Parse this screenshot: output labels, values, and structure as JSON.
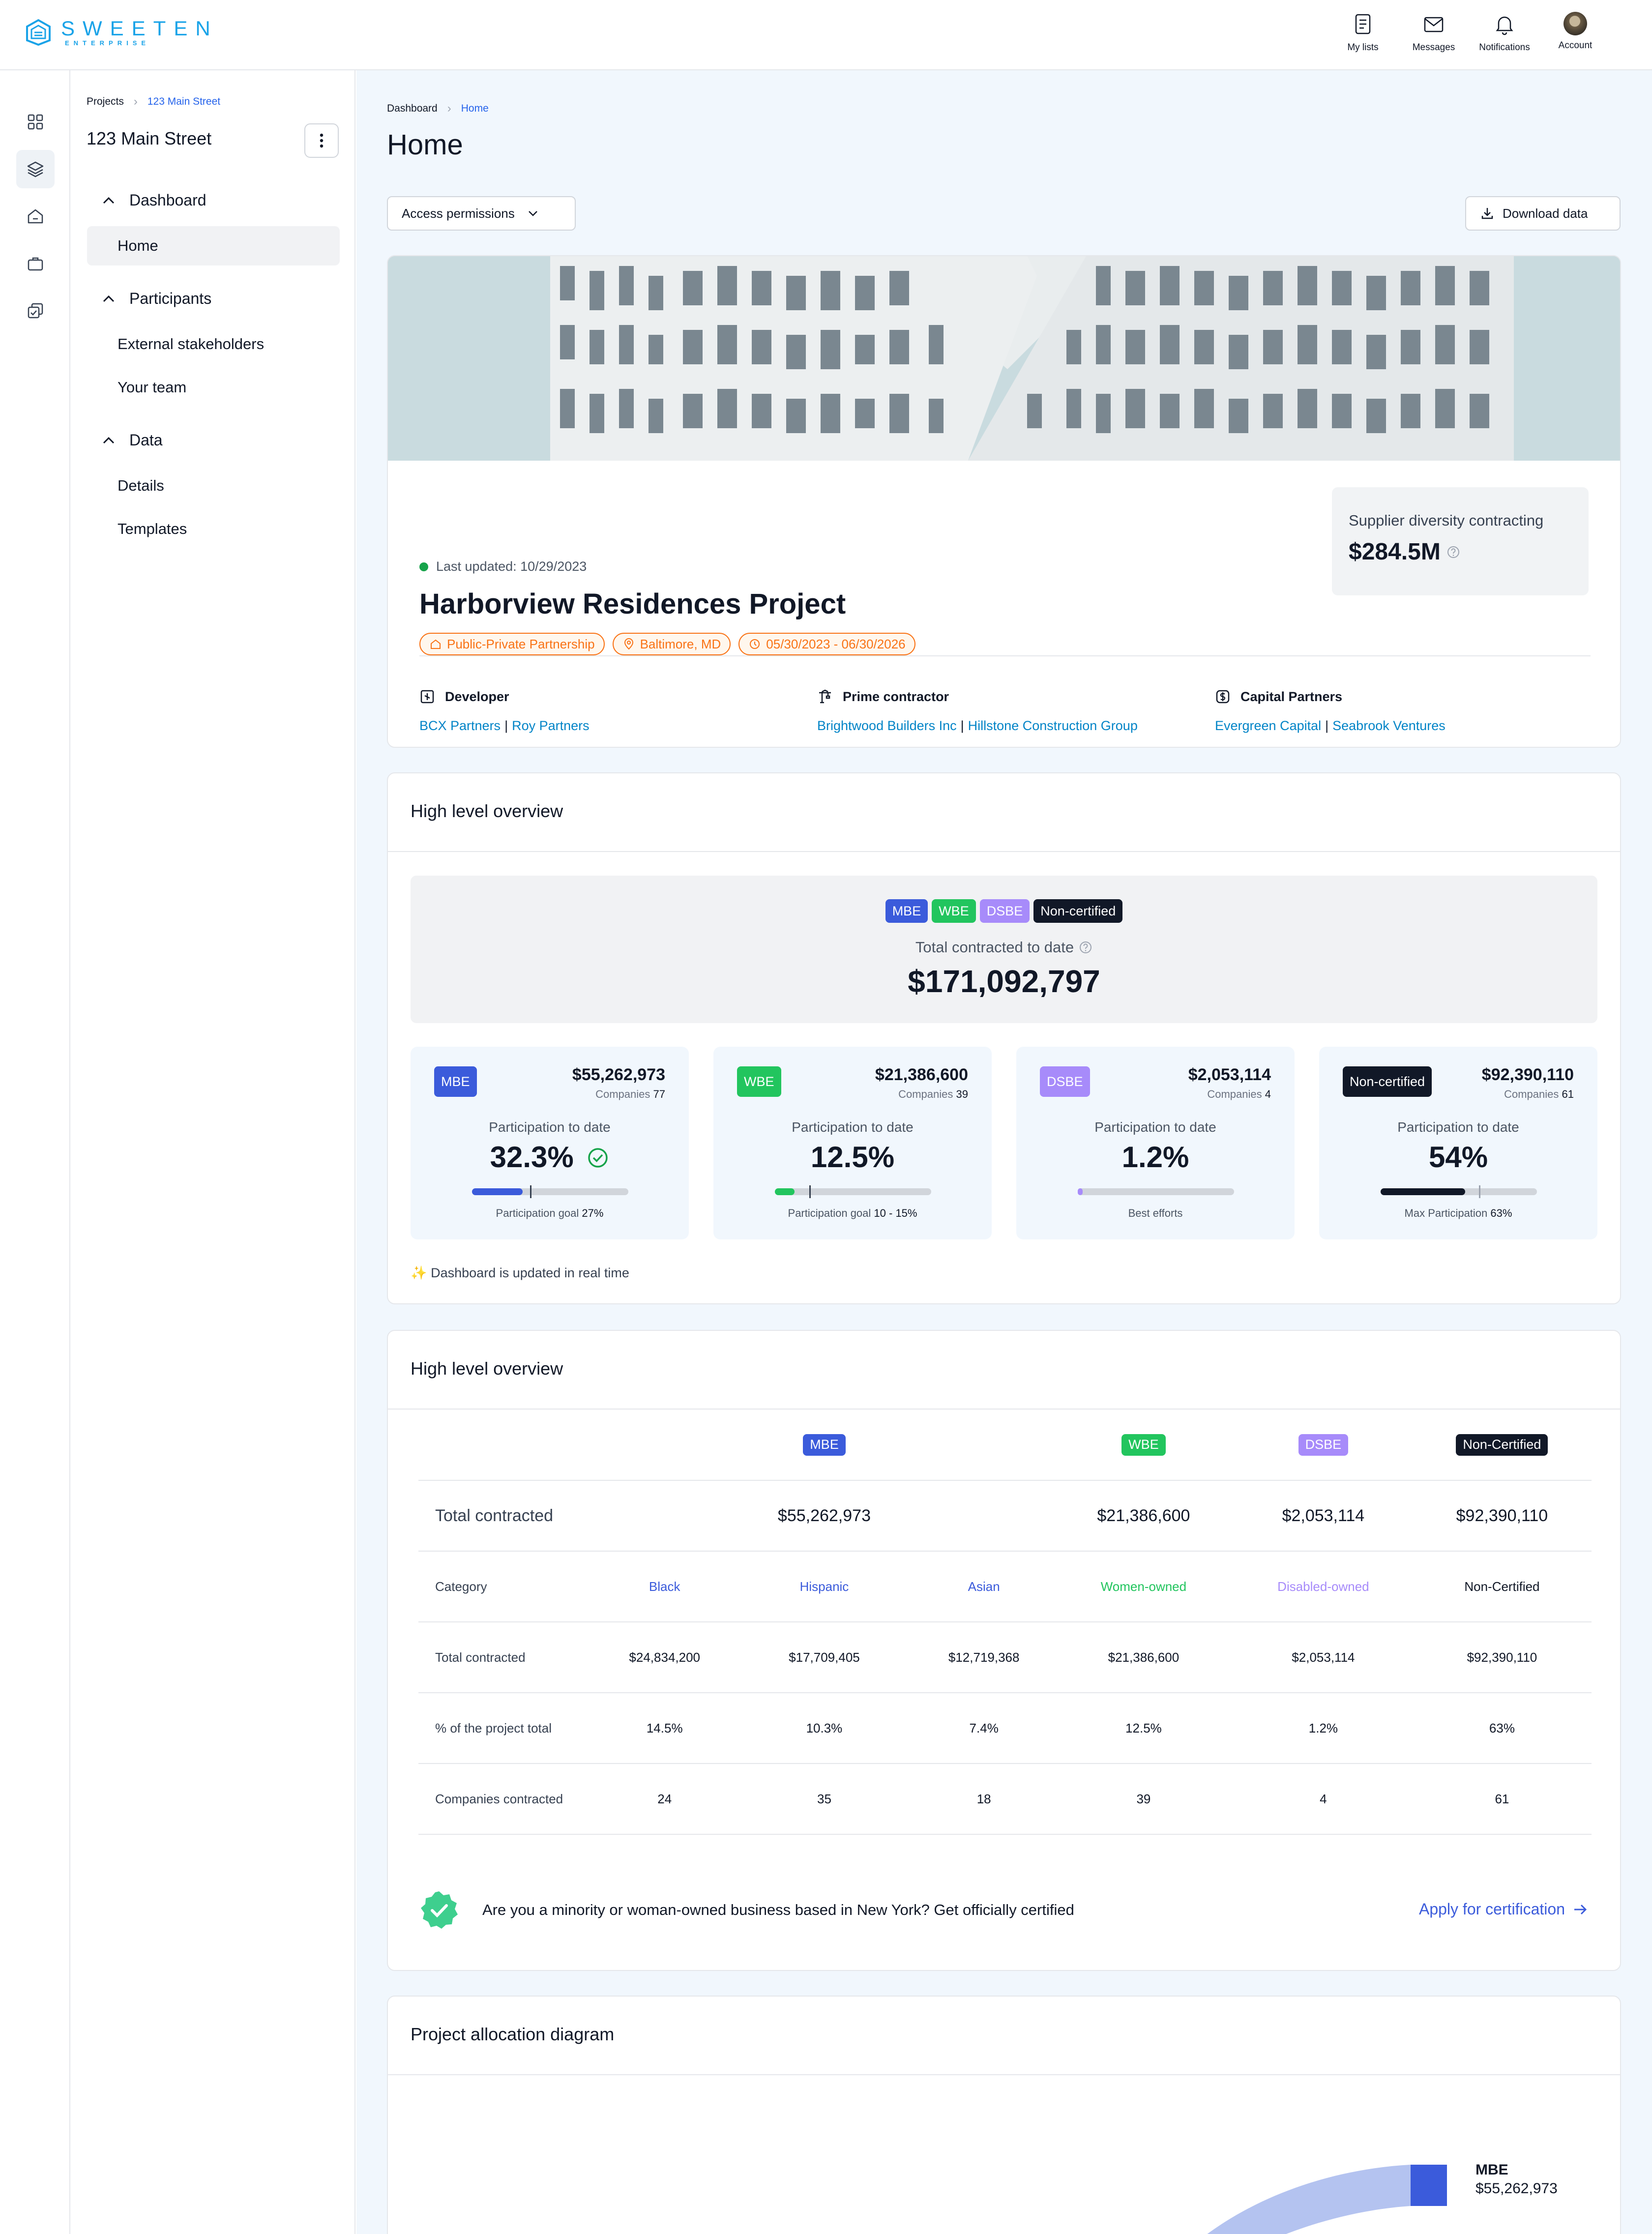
{
  "brand": {
    "name": "SWEETEN",
    "sub": "ENTERPRISE"
  },
  "topnav": [
    {
      "label": "My lists",
      "icon": "list-icon"
    },
    {
      "label": "Messages",
      "icon": "mail-icon"
    },
    {
      "label": "Notifications",
      "icon": "bell-icon"
    },
    {
      "label": "Account",
      "icon": "avatar"
    }
  ],
  "sidebar": {
    "breadcrumb": {
      "root": "Projects",
      "current": "123 Main Street"
    },
    "title": "123 Main Street",
    "groups": [
      {
        "label": "Dashboard",
        "items": [
          "Home"
        ]
      },
      {
        "label": "Participants",
        "items": [
          "External stakeholders",
          "Your team"
        ]
      },
      {
        "label": "Data",
        "items": [
          "Details",
          "Templates"
        ]
      }
    ]
  },
  "page": {
    "breadcrumb": {
      "root": "Dashboard",
      "current": "Home"
    },
    "title": "Home",
    "access_button": "Access permissions",
    "download_button": "Download data"
  },
  "project": {
    "last_updated": "Last updated: 10/29/2023",
    "name": "Harborview Residences Project",
    "tags": [
      "Public-Private Partnership",
      "Baltimore, MD",
      "05/30/2023 - 06/30/2026"
    ],
    "sdc_label": "Supplier diversity contracting",
    "sdc_value": "$284.5M",
    "parties": [
      {
        "role": "Developer",
        "names": [
          "BCX Partners",
          "Roy Partners"
        ]
      },
      {
        "role": "Prime contractor",
        "names": [
          "Brightwood Builders Inc",
          "Hillstone Construction Group"
        ]
      },
      {
        "role": "Capital Partners",
        "names": [
          "Evergreen Capital",
          "Seabrook Ventures"
        ]
      }
    ]
  },
  "overview": {
    "title": "High level overview",
    "badges": [
      "MBE",
      "WBE",
      "DSBE",
      "Non-certified"
    ],
    "total_label": "Total contracted to date",
    "total_value": "$171,092,797",
    "cards": [
      {
        "badge": "MBE",
        "amount": "$55,262,973",
        "companies_label": "Companies",
        "companies": "77",
        "part_label": "Participation to date",
        "pct": "32.3%",
        "progress": 0.323,
        "goal_marker": 0.37,
        "goal_label": "Participation goal",
        "goal": "27%",
        "color": "#3b5bdb"
      },
      {
        "badge": "WBE",
        "amount": "$21,386,600",
        "companies_label": "Companies",
        "companies": "39",
        "part_label": "Participation to date",
        "pct": "12.5%",
        "progress": 0.125,
        "goal_marker": 0.22,
        "goal_label": "Participation goal",
        "goal": "10 - 15%",
        "color": "#22c55e"
      },
      {
        "badge": "DSBE",
        "amount": "$2,053,114",
        "companies_label": "Companies",
        "companies": "4",
        "part_label": "Participation to date",
        "pct": "1.2%",
        "progress": 0.012,
        "goal_label": "Best efforts",
        "goal": "",
        "color": "#a78bfa"
      },
      {
        "badge": "Non-certified",
        "amount": "$92,390,110",
        "companies_label": "Companies",
        "companies": "61",
        "part_label": "Participation to date",
        "pct": "54%",
        "progress": 0.54,
        "goal_marker": 0.63,
        "goal_label": "Max Participation",
        "goal": "63%",
        "color": "#111827"
      }
    ],
    "note": "✨ Dashboard is updated in real time"
  },
  "overview2": {
    "title": "High level overview",
    "header_badges": [
      "MBE",
      "WBE",
      "DSBE",
      "Non-Certified"
    ],
    "row_total_label": "Total contracted",
    "group_totals": [
      "$55,262,973",
      "$21,386,600",
      "$2,053,114",
      "$92,390,110"
    ],
    "category_label": "Category",
    "categories": [
      "Black",
      "Hispanic",
      "Asian",
      "Women-owned",
      "Disabled-owned",
      "Non-Certified"
    ],
    "rows": [
      {
        "label": "Total contracted",
        "values": [
          "$24,834,200",
          "$17,709,405",
          "$12,719,368",
          "$21,386,600",
          "$2,053,114",
          "$92,390,110"
        ]
      },
      {
        "label": "% of the project total",
        "values": [
          "14.5%",
          "10.3%",
          "7.4%",
          "12.5%",
          "1.2%",
          "63%"
        ]
      },
      {
        "label": "Companies contracted",
        "values": [
          "24",
          "35",
          "18",
          "39",
          "4",
          "61"
        ]
      }
    ],
    "cta_text": "Are you a minority or woman-owned business based in New York? Get officially certified",
    "cta_link": "Apply for certification"
  },
  "allocation": {
    "title": "Project allocation diagram",
    "legend_label": "MBE",
    "legend_value": "$55,262,973"
  }
}
